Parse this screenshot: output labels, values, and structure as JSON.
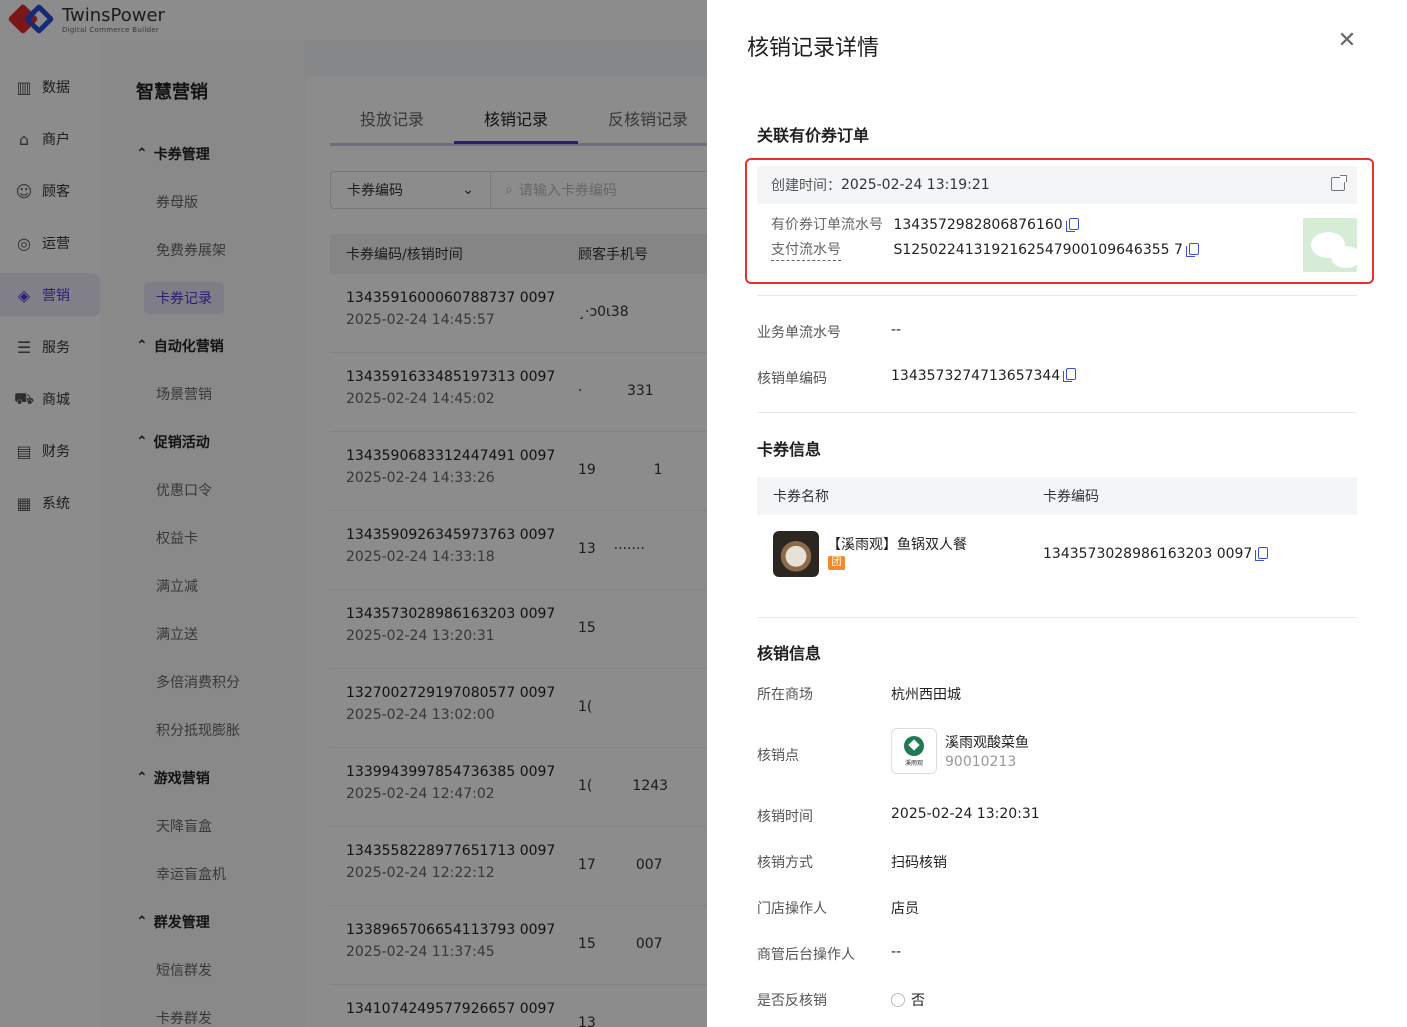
{
  "brand": {
    "name": "TwinsPower",
    "tagline": "Digital Commerce Builder"
  },
  "nav": [
    {
      "label": "数据",
      "icon": "chart-icon"
    },
    {
      "label": "商户",
      "icon": "store-icon"
    },
    {
      "label": "顾客",
      "icon": "users-icon"
    },
    {
      "label": "运营",
      "icon": "operation-icon"
    },
    {
      "label": "营销",
      "icon": "marketing-icon",
      "active": true
    },
    {
      "label": "服务",
      "icon": "list-icon"
    },
    {
      "label": "商城",
      "icon": "cart-icon"
    },
    {
      "label": "财务",
      "icon": "finance-icon"
    },
    {
      "label": "系统",
      "icon": "grid-icon"
    }
  ],
  "subnav": {
    "title": "智慧营销",
    "groups": [
      {
        "label": "卡券管理",
        "items": [
          "券母版",
          "免费券展架",
          "卡券记录"
        ]
      },
      {
        "label": "自动化营销",
        "items": [
          "场景营销"
        ]
      },
      {
        "label": "促销活动",
        "items": [
          "优惠口令",
          "权益卡",
          "满立减",
          "满立送",
          "多倍消费积分",
          "积分抵现膨胀"
        ]
      },
      {
        "label": "游戏营销",
        "items": [
          "天降盲盒",
          "幸运盲盒机"
        ]
      },
      {
        "label": "群发管理",
        "items": [
          "短信群发",
          "卡券群发"
        ]
      }
    ],
    "active": "卡券记录"
  },
  "tabs": [
    "投放记录",
    "核销记录",
    "反核销记录"
  ],
  "filter": {
    "select": "卡券编码",
    "placeholder": "请输入卡券编码"
  },
  "table": {
    "headers": [
      "卡券编码/核销时间",
      "顾客手机号"
    ],
    "rows": [
      {
        "code": "1343591600060788737 0097",
        "time": "2025-02-24 14:45:57",
        "phone": "¸·ɔ0ɩ38"
      },
      {
        "code": "1343591633485197313 0097",
        "time": "2025-02-24 14:45:02",
        "phone": "·          331"
      },
      {
        "code": "1343590683312447491 0097",
        "time": "2025-02-24 14:33:26",
        "phone": "19             1"
      },
      {
        "code": "1343590926345973763 0097",
        "time": "2025-02-24 14:33:18",
        "phone": "13    ·······"
      },
      {
        "code": "1343573028986163203 0097",
        "time": "2025-02-24 13:20:31",
        "phone": "15"
      },
      {
        "code": "1327002729197080577 0097",
        "time": "2025-02-24 13:02:00",
        "phone": "1("
      },
      {
        "code": "1339943997854736385 0097",
        "time": "2025-02-24 12:47:02",
        "phone": "1(         1243"
      },
      {
        "code": "1343558228977651713 0097",
        "time": "2025-02-24 12:22:12",
        "phone": "17         007"
      },
      {
        "code": "1338965706654113793 0097",
        "time": "2025-02-24 11:37:45",
        "phone": "15         007"
      },
      {
        "code": "1341074249577926657 0097",
        "time": "",
        "phone": "13"
      }
    ]
  },
  "drawer": {
    "title": "核销记录详情",
    "order_section": "关联有价券订单",
    "created_label": "创建时间：",
    "created_value": "2025-02-24 13:19:21",
    "order_no_label": "有价券订单流水号",
    "order_no": "1343572982806876160",
    "pay_no_label": "支付流水号",
    "pay_no": "S125022413192162547900109646355 7",
    "biz_no_label": "业务单流水号",
    "biz_no": "--",
    "writeoff_no_label": "核销单编码",
    "writeoff_no": "1343573274713657344",
    "coupon_section": "卡券信息",
    "coupon_headers": [
      "卡券名称",
      "卡券编码"
    ],
    "coupon_name": "【溪雨观】鱼锅双人餐",
    "coupon_tag": "团",
    "coupon_code": "1343573028986163203 0097",
    "writeoff_section": "核销信息",
    "mall_label": "所在商场",
    "mall": "杭州西田城",
    "point_label": "核销点",
    "store_logo_text": "溪雨观",
    "store_name": "溪雨观酸菜鱼",
    "store_id": "90010213",
    "time_label": "核销时间",
    "time": "2025-02-24 13:20:31",
    "method_label": "核销方式",
    "method": "扫码核销",
    "store_op_label": "门店操作人",
    "store_op": "店员",
    "admin_op_label": "商管后台操作人",
    "admin_op": "--",
    "reverse_label": "是否反核销",
    "reverse": "否"
  },
  "colors": {
    "accent": "#4b3ad0",
    "highlight_border": "#e8302f",
    "copy": "#3d4fd6"
  }
}
